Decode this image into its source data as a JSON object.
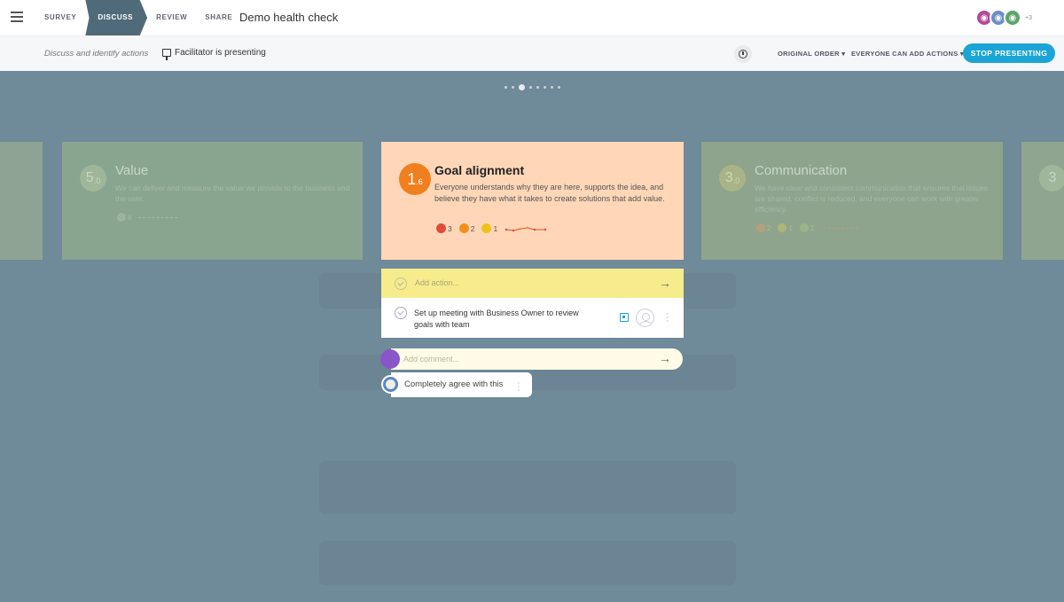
{
  "nav": {
    "steps": [
      "SURVEY",
      "DISCUSS",
      "REVIEW",
      "SHARE"
    ],
    "active_step": "DISCUSS",
    "title": "Demo health check",
    "extra_participants": "+3"
  },
  "subbar": {
    "hint": "Discuss and identify actions",
    "presenting": "Facilitator is presenting",
    "order_label": "ORIGINAL ORDER ▾",
    "actions_label": "EVERYONE CAN ADD ACTIONS ▾",
    "stop_label": "STOP PRESENTING"
  },
  "cards": {
    "value": {
      "score_int": "5",
      "score_dec": ".0",
      "title": "Value",
      "description": "We can deliver and measure the value we provide to the business and the user.",
      "vote": "6"
    },
    "goal": {
      "score_int": "1",
      "score_dec": ".6",
      "title": "Goal alignment",
      "description": "Everyone understands why they are here, supports the idea, and believe they have what it takes to create solutions that add value.",
      "votes": {
        "red": "3",
        "orange": "2",
        "yellow": "1"
      }
    },
    "communication": {
      "score_int": "3",
      "score_dec": ".0",
      "title": "Communication",
      "description": "We have clear and consistent communication that ensures that issues are shared, conflict is reduced, and everyone can work with greater efficiency.",
      "votes": {
        "a": "2",
        "b": "1",
        "c": "1"
      }
    },
    "right_edge": {
      "score_int": "3"
    }
  },
  "actions": {
    "add_placeholder": "Add action...",
    "items": [
      {
        "text": "Set up meeting with Business Owner to review goals with team"
      }
    ]
  },
  "comments": {
    "add_placeholder": "Add comment...",
    "items": [
      {
        "text": "Completely agree with this"
      }
    ]
  }
}
